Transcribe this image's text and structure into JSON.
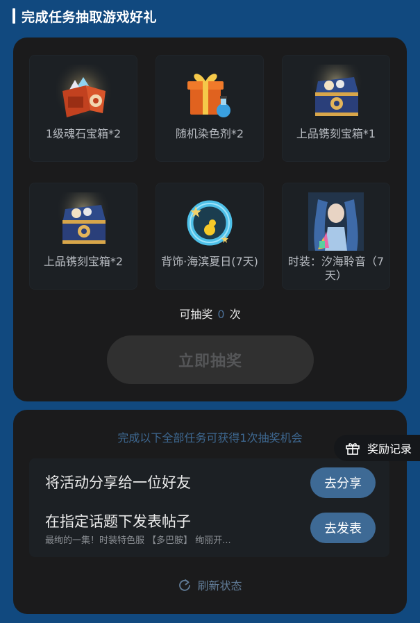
{
  "header": {
    "title": "完成任务抽取游戏好礼"
  },
  "prizes": [
    {
      "icon": "soul-stone-chest-icon",
      "label": "1级魂石宝箱*2"
    },
    {
      "icon": "gift-box-dye-icon",
      "label": "随机染色剂*2"
    },
    {
      "icon": "engraving-chest-icon",
      "label": "上品镌刻宝箱*1"
    },
    {
      "icon": "engraving-chest-icon",
      "label": "上品镌刻宝箱*2"
    },
    {
      "icon": "back-accessory-ring-icon",
      "label": "背饰·海滨夏日(7天)"
    },
    {
      "icon": "costume-portrait-icon",
      "label": "时装：汐海聆音（7天）"
    }
  ],
  "draw": {
    "prefix": "可抽奖",
    "count": "0",
    "suffix": "次",
    "button_label": "立即抽奖"
  },
  "tasks": {
    "hint": "完成以下全部任务可获得1次抽奖机会",
    "items": [
      {
        "title": "将活动分享给一位好友",
        "subtitle": "",
        "button_label": "去分享"
      },
      {
        "title": "在指定话题下发表帖子",
        "subtitle": "最绚的一集！时装特色服 【多巴胺】 绚丽开...",
        "button_label": "去发表"
      }
    ],
    "refresh_label": "刷新状态"
  },
  "reward_tab": {
    "icon": "gift-icon",
    "label": "奖励记录"
  },
  "colors": {
    "page_bg": "#11497f",
    "panel_bg": "#1b1b1c",
    "tile_bg": "#1c2024",
    "accent_button": "#3e6a95",
    "disabled_button": "#303030",
    "hint_text": "#3e6891"
  }
}
